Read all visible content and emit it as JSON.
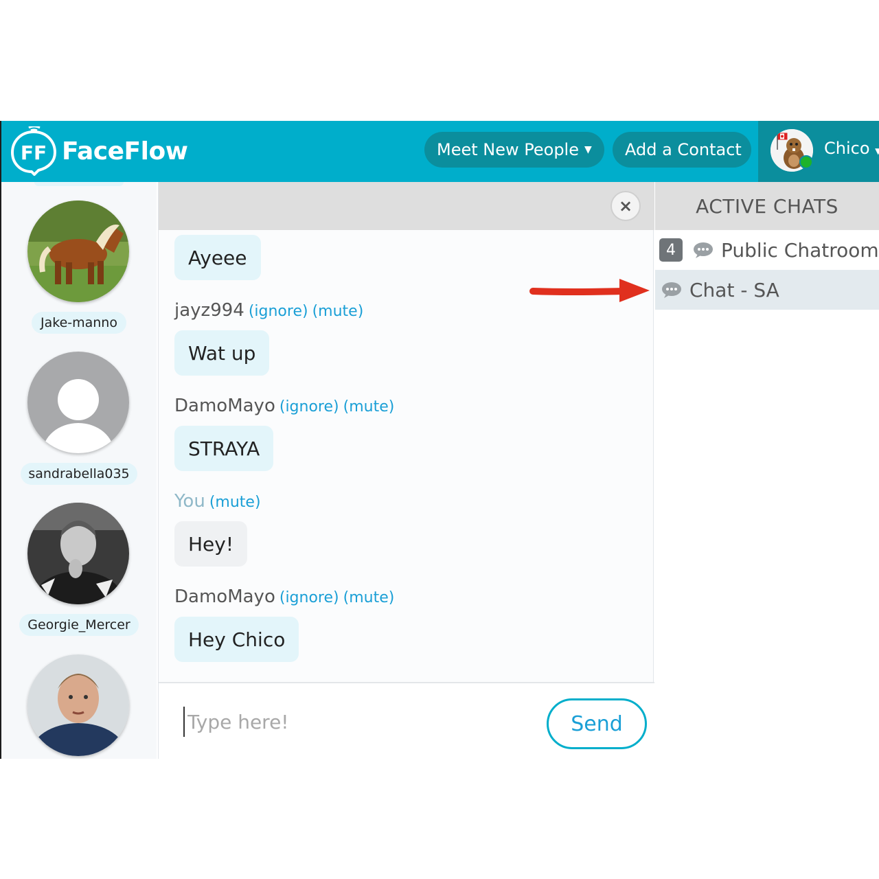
{
  "app": {
    "brand": "FaceFlow",
    "brand_mark": "FF"
  },
  "header": {
    "meet_new_people": "Meet New People",
    "add_contact": "Add a Contact",
    "user_name": "Chico"
  },
  "contacts": [
    {
      "name": "Jake-manno",
      "avatar": "horse-photo"
    },
    {
      "name": "sandrabella035",
      "avatar": "default-avatar"
    },
    {
      "name": "Georgie_Mercer",
      "avatar": "bw-person-photo"
    },
    {
      "name": "",
      "avatar": "boy-photo"
    }
  ],
  "chat": {
    "messages": [
      {
        "sender": "",
        "text": "Ayeee"
      },
      {
        "sender": "jayz994",
        "ignore": "(ignore)",
        "mute": "(mute)",
        "text": "Wat up"
      },
      {
        "sender": "DamoMayo",
        "ignore": "(ignore)",
        "mute": "(mute)",
        "text": "STRAYA"
      },
      {
        "sender": "You",
        "mute": "(mute)",
        "text": "Hey!"
      },
      {
        "sender": "DamoMayo",
        "ignore": "(ignore)",
        "mute": "(mute)",
        "text": "Hey Chico"
      }
    ],
    "input_placeholder": "Type here!",
    "send_label": "Send",
    "close_icon": "×"
  },
  "active_chats": {
    "title": "ACTIVE CHATS",
    "items": [
      {
        "badge": "4",
        "label": "Public Chatroom",
        "icon": "chat-bubble-icon"
      },
      {
        "label": "Chat - SA",
        "icon": "chat-bubble-icon"
      }
    ]
  },
  "colors": {
    "header": "#00aecb",
    "header_dark": "#0b8e9d",
    "bubble": "#e3f5fa",
    "link": "#1a9fd6",
    "arrow": "#e0301e"
  }
}
